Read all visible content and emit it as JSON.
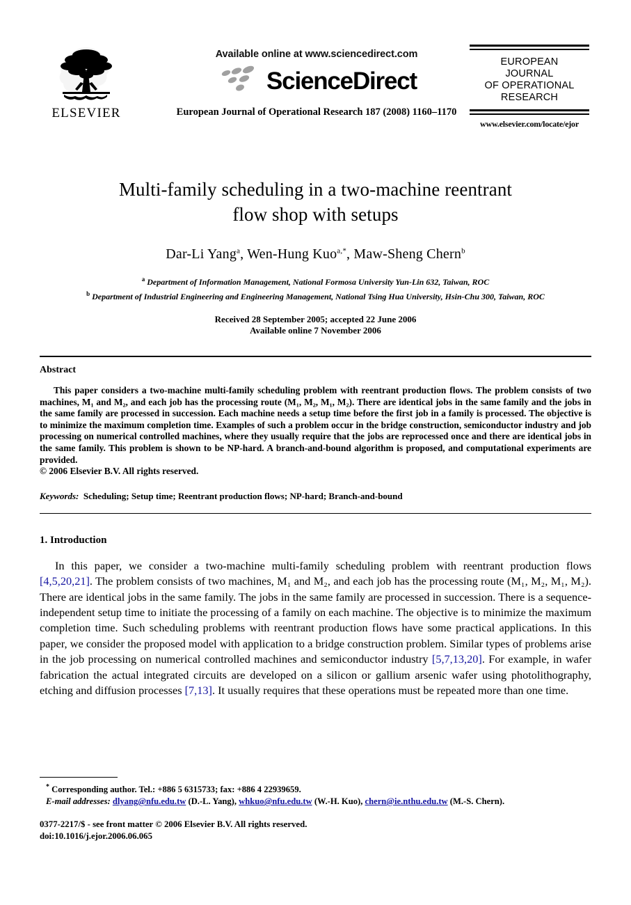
{
  "publisher": {
    "name": "ELSEVIER",
    "logo_icon": "elsevier-tree-logo"
  },
  "sciencedirect": {
    "available_line": "Available online at www.sciencedirect.com",
    "wordmark": "ScienceDirect",
    "logo_icon": "sciencedirect-dots-logo",
    "journal_citation": "European Journal of Operational Research 187 (2008) 1160–1170"
  },
  "journal_badge": {
    "line1": "EUROPEAN",
    "line2": "JOURNAL",
    "line3": "OF OPERATIONAL",
    "line4": "RESEARCH",
    "url": "www.elsevier.com/locate/ejor"
  },
  "article": {
    "title_line1": "Multi-family scheduling in a two-machine reentrant",
    "title_line2": "flow shop with setups",
    "authors": [
      {
        "name": "Dar-Li Yang",
        "marks": "a"
      },
      {
        "name": "Wen-Hung Kuo",
        "marks": "a,*"
      },
      {
        "name": "Maw-Sheng Chern",
        "marks": "b"
      }
    ],
    "affiliations": [
      {
        "mark": "a",
        "text": "Department of Information Management, National Formosa University Yun-Lin 632, Taiwan, ROC"
      },
      {
        "mark": "b",
        "text": "Department of Industrial Engineering and Engineering Management, National Tsing Hua University, Hsin-Chu 300, Taiwan, ROC"
      }
    ],
    "history_line1": "Received 28 September 2005; accepted 22 June 2006",
    "history_line2": "Available online 7 November 2006"
  },
  "abstract": {
    "heading": "Abstract",
    "paragraph": "This paper considers a two-machine multi-family scheduling problem with reentrant production flows. The problem consists of two machines, M₁ and M₂, and each job has the processing route (M₁, M₂, M₁, M₂). There are identical jobs in the same family and the jobs in the same family are processed in succession. Each machine needs a setup time before the first job in a family is processed. The objective is to minimize the maximum completion time. Examples of such a problem occur in the bridge construction, semiconductor industry and job processing on numerical controlled machines, where they usually require that the jobs are reprocessed once and there are identical jobs in the same family. This problem is shown to be NP-hard. A branch-and-bound algorithm is proposed, and computational experiments are provided.",
    "copyright": "© 2006 Elsevier B.V. All rights reserved.",
    "keywords_label": "Keywords:",
    "keywords_value": "Scheduling; Setup time; Reentrant production flows; NP-hard; Branch-and-bound"
  },
  "introduction": {
    "heading": "1. Introduction",
    "part1": "In this paper, we consider a two-machine multi-family scheduling problem with reentrant production flows ",
    "ref1": "[4,5,20,21]",
    "part2": ". The problem consists of two machines, M₁ and M₂, and each job has the processing route (M₁, M₂, M₁, M₂). There are identical jobs in the same family. The jobs in the same family are processed in succession. There is a sequence-independent setup time to initiate the processing of a family on each machine. The objective is to minimize the maximum completion time. Such scheduling problems with reentrant production flows have some practical applications. In this paper, we consider the proposed model with application to a bridge construction problem. Similar types of problems arise in the job processing on numerical controlled machines and semiconductor industry ",
    "ref2": "[5,7,13,20]",
    "part3": ". For example, in wafer fabrication the actual integrated circuits are developed on a silicon or gallium arsenic wafer using photolithography, etching and diffusion processes ",
    "ref3": "[7,13]",
    "part4": ". It usually requires that these operations must be repeated more than one time."
  },
  "footnotes": {
    "corresponding_mark": "*",
    "corresponding": "Corresponding author. Tel.: +886 5 6315733; fax: +886 4 22939659.",
    "email_label": "E-mail addresses:",
    "emails": [
      {
        "address": "dlyang@nfu.edu.tw",
        "person": "(D.-L. Yang),"
      },
      {
        "address": "whkuo@nfu.edu.tw",
        "person": "(W.-H. Kuo),"
      },
      {
        "address": "chern@ie.nthu.edu.tw",
        "person": "(M.-S. Chern)."
      }
    ]
  },
  "colophon": {
    "line1": "0377-2217/$ - see front matter © 2006 Elsevier B.V. All rights reserved.",
    "line2": "doi:10.1016/j.ejor.2006.06.065"
  },
  "colors": {
    "link": "#1414a0",
    "text": "#000000",
    "background": "#ffffff"
  }
}
